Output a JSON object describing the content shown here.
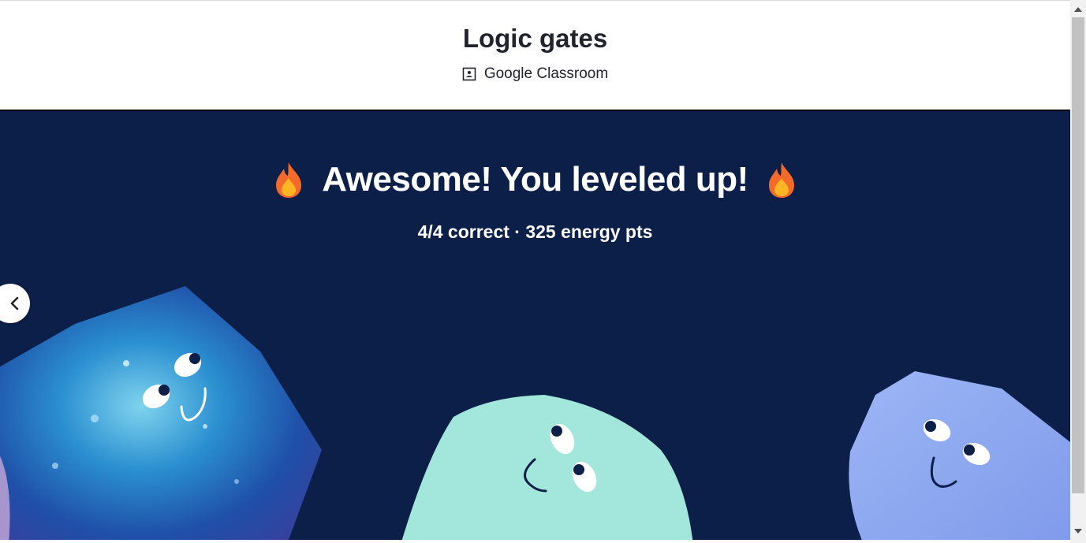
{
  "header": {
    "title": "Logic gates",
    "classroom_label": "Google Classroom",
    "classroom_icon": "google-classroom-icon"
  },
  "result": {
    "headline": "Awesome! You leveled up!",
    "headline_icon": "fire-emoji-icon",
    "stats": "4/4 correct · 325 energy pts"
  },
  "navigation": {
    "back_icon": "chevron-left-icon"
  },
  "colors": {
    "panel_background": "#0c1f48",
    "creature_left": "#2f64c4",
    "creature_middle": "#a3e6dc",
    "creature_right": "#8fa9f2",
    "flame_outer": "#f36a2a",
    "flame_inner": "#ffb524"
  }
}
